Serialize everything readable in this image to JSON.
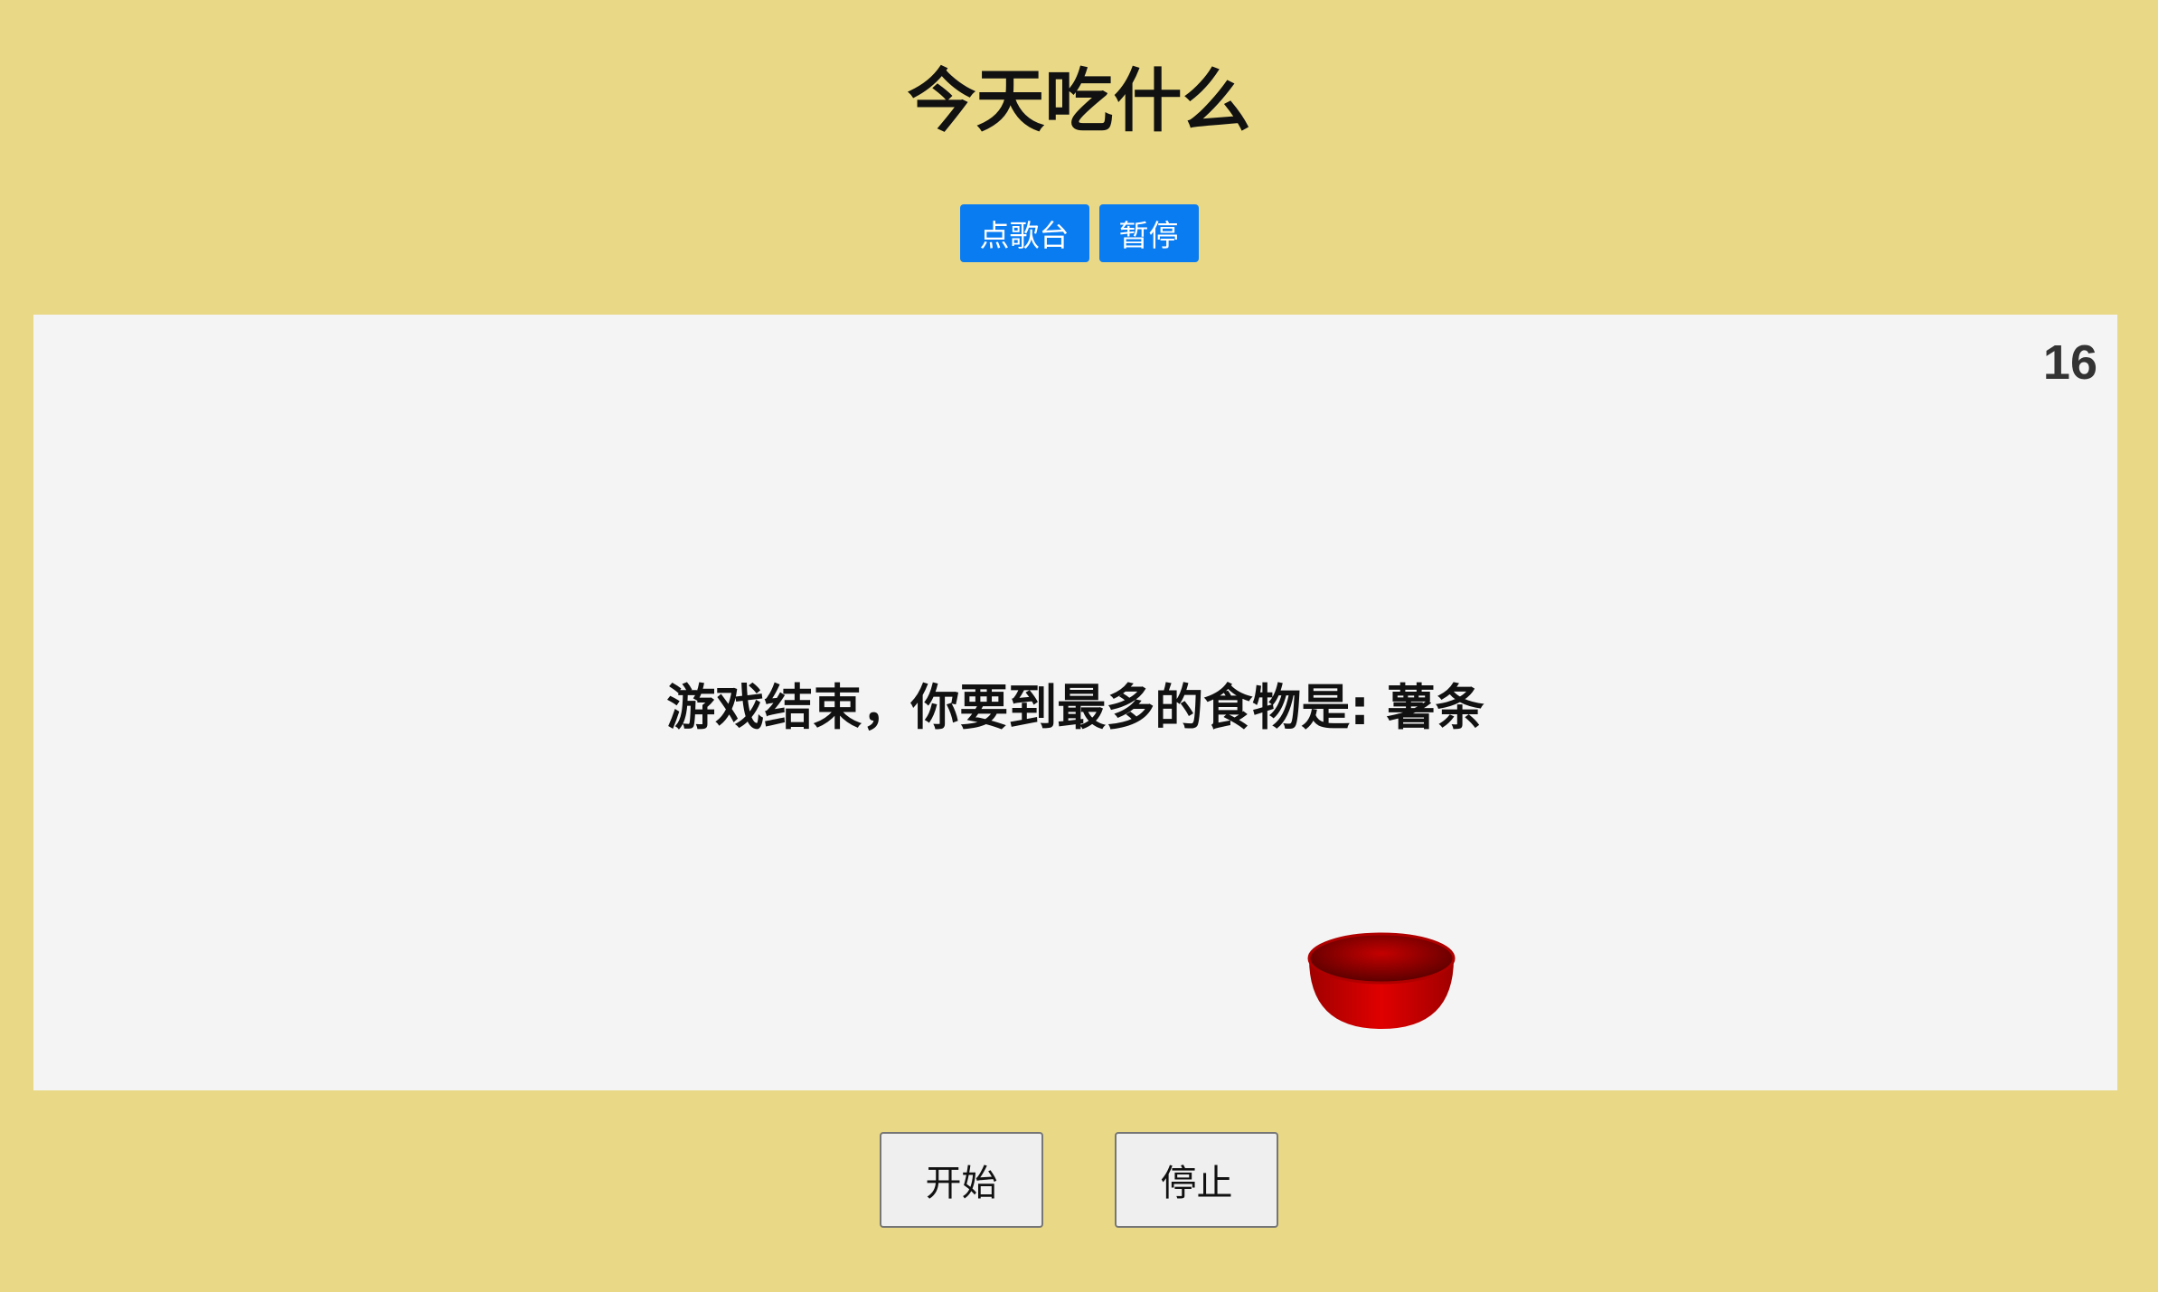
{
  "page": {
    "title": "今天吃什么",
    "background_color": "#e9d987"
  },
  "top_buttons": {
    "song_label": "点歌台",
    "pause_label": "暂停",
    "color": "#0a7cf2"
  },
  "game": {
    "score": "16",
    "result_text": "游戏结束，你要到最多的食物是: 薯条",
    "bowl_color": "#cc0000",
    "bowl_icon": "red-bowl-icon"
  },
  "bottom_buttons": {
    "start_label": "开始",
    "stop_label": "停止"
  }
}
